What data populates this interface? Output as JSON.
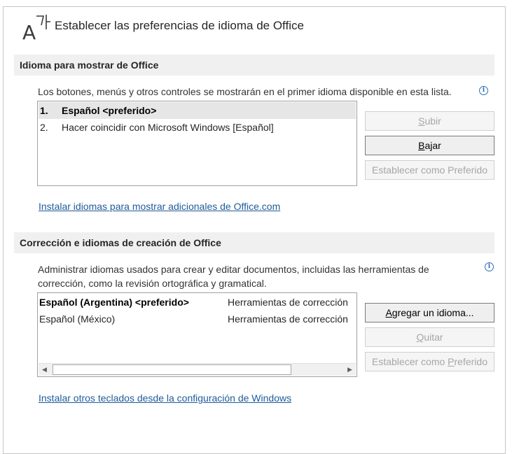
{
  "header": {
    "title": "Establecer las preferencias de idioma de Office",
    "icon": "language-az-icon"
  },
  "display_section": {
    "heading": "Idioma para mostrar de Office",
    "description": "Los botones, menús y otros controles se mostrarán en el primer idioma disponible en esta lista.",
    "languages": [
      {
        "num": "1.",
        "name": "Español <preferido>",
        "selected": true
      },
      {
        "num": "2.",
        "name": "Hacer coincidir con Microsoft Windows [Español]",
        "selected": false
      }
    ],
    "buttons": {
      "up_pre": "",
      "up_key": "S",
      "up_post": "ubir",
      "down_pre": "",
      "down_key": "B",
      "down_post": "ajar",
      "preferred": "Establecer como Preferido"
    },
    "install_link": "Instalar idiomas para mostrar adicionales de Office.com"
  },
  "authoring_section": {
    "heading": "Corrección e idiomas de creación de Office",
    "description_line1": "Administrar idiomas usados para crear y editar documentos, incluidas las herramientas de",
    "description_line2": "corrección, como la revisión ortográfica y gramatical.",
    "languages": [
      {
        "name": "Español (Argentina) <preferido>",
        "tools": "Herramientas de corrección"
      },
      {
        "name": "Español (México)",
        "tools": "Herramientas de corrección"
      }
    ],
    "buttons": {
      "add_pre": "",
      "add_key": "A",
      "add_post": "gregar un idioma...",
      "remove_pre": "",
      "remove_key": "Q",
      "remove_post": "uitar",
      "preferred_pre": "Establecer como ",
      "preferred_key": "P",
      "preferred_post": "referido"
    },
    "keyboards_link": "Instalar otros teclados desde la configuración de Windows"
  }
}
